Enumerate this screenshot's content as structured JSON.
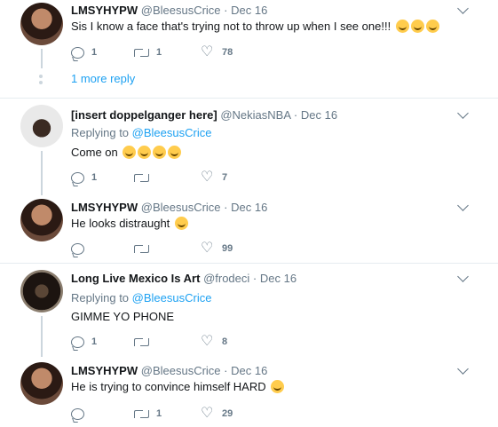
{
  "tweets": [
    {
      "name": "LMSYHYPW",
      "handle": "@BleesusCrice",
      "time": "Dec 16",
      "text": "Sis I know a face that's trying not to throw up when I see one!!!",
      "emojis": 3,
      "replies": "1",
      "retweets": "1",
      "likes": "78",
      "more_replies": "1 more reply"
    },
    {
      "name": "[insert doppelganger here]",
      "handle": "@NekiasNBA",
      "time": "Dec 16",
      "replying_prefix": "Replying to",
      "replying_to": "@BleesusCrice",
      "text": "Come on",
      "emojis": 4,
      "replies": "1",
      "retweets": "",
      "likes": "7"
    },
    {
      "name": "LMSYHYPW",
      "handle": "@BleesusCrice",
      "time": "Dec 16",
      "text": "He looks distraught",
      "emojis": 1,
      "replies": "",
      "retweets": "",
      "likes": "99"
    },
    {
      "name": "Long Live Mexico Is Art",
      "handle": "@frodeci",
      "time": "Dec 16",
      "replying_prefix": "Replying to",
      "replying_to": "@BleesusCrice",
      "text": "GIMME YO PHONE",
      "emojis": 0,
      "replies": "1",
      "retweets": "",
      "likes": "8"
    },
    {
      "name": "LMSYHYPW",
      "handle": "@BleesusCrice",
      "time": "Dec 16",
      "text": "He is trying to convince himself HARD",
      "emojis": 1,
      "replies": "",
      "retweets": "1",
      "likes": "29"
    }
  ],
  "separator": "·",
  "icons": {
    "reply": "reply-icon",
    "retweet": "retweet-icon",
    "like": "heart-icon",
    "menu": "chevron-down-icon"
  },
  "colors": {
    "link": "#1da1f2",
    "muted": "#657786",
    "divider": "#e6ecf0"
  }
}
